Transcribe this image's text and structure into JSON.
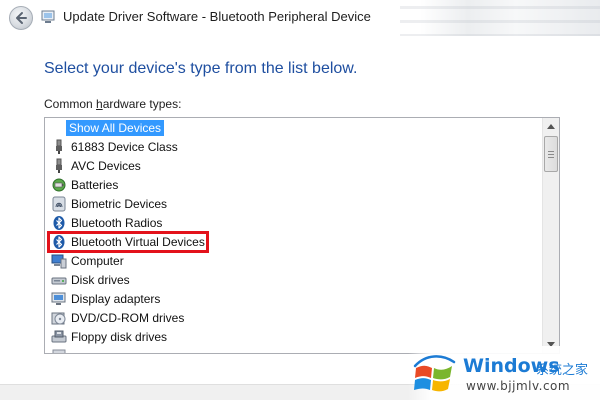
{
  "window": {
    "title": "Update Driver Software - Bluetooth Peripheral Device"
  },
  "heading": "Select your device's type from the list below.",
  "list": {
    "label_prefix": "Common ",
    "label_accel": "h",
    "label_suffix": "ardware types:",
    "items": [
      {
        "label": "Show All Devices",
        "icon": "none",
        "selected": true
      },
      {
        "label": "61883 Device Class",
        "icon": "connector-plug-icon"
      },
      {
        "label": "AVC Devices",
        "icon": "connector-plug-icon"
      },
      {
        "label": "Batteries",
        "icon": "battery-icon"
      },
      {
        "label": "Biometric Devices",
        "icon": "fingerprint-icon"
      },
      {
        "label": "Bluetooth Radios",
        "icon": "bluetooth-icon"
      },
      {
        "label": "Bluetooth Virtual Devices",
        "icon": "bluetooth-icon",
        "highlighted": true
      },
      {
        "label": "Computer",
        "icon": "computer-icon"
      },
      {
        "label": "Disk drives",
        "icon": "disk-drive-icon"
      },
      {
        "label": "Display adapters",
        "icon": "display-adapter-icon"
      },
      {
        "label": "DVD/CD-ROM drives",
        "icon": "dvd-drive-icon"
      },
      {
        "label": "Floppy disk drives",
        "icon": "floppy-drive-icon"
      }
    ],
    "scroll_position": 0.0
  },
  "watermark": {
    "brand": "Windows",
    "brand_cn": "系统之家",
    "url": "www.bjjmlv.com"
  },
  "colors": {
    "heading": "#1f4fa0",
    "selection": "#3399ff",
    "highlight_border": "#e3121b",
    "watermark_blue": "#1c7bd4"
  }
}
